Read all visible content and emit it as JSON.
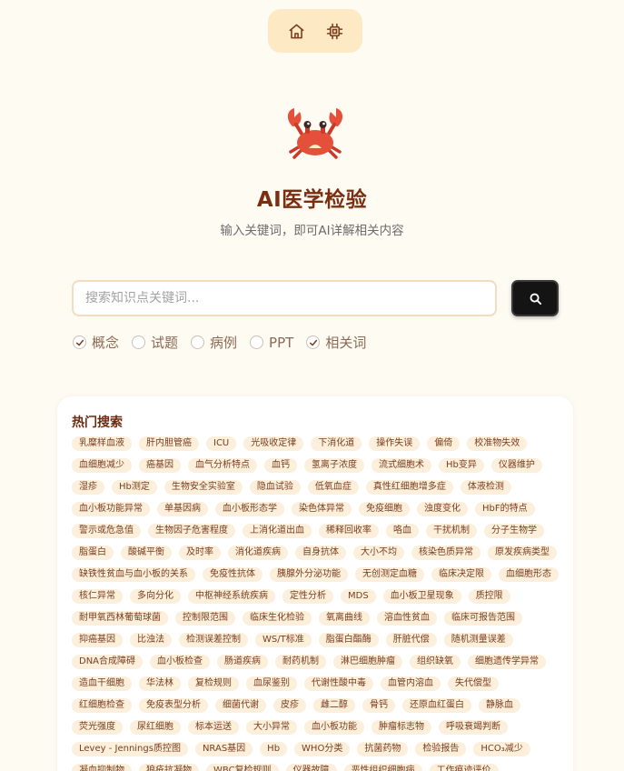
{
  "nav": {
    "home_icon": "home-icon",
    "chip_icon": "chip-icon"
  },
  "hero": {
    "logo_icon": "crab-icon",
    "title": "AI医学检验",
    "subtitle": "输入关键词，即可AI详解相关内容"
  },
  "search": {
    "placeholder": "搜索知识点关键词...",
    "value": "",
    "button_icon": "search-icon"
  },
  "options": [
    {
      "label": "概念",
      "checked": true
    },
    {
      "label": "试题",
      "checked": false
    },
    {
      "label": "病例",
      "checked": false
    },
    {
      "label": "PPT",
      "checked": false
    },
    {
      "label": "相关词",
      "checked": true
    }
  ],
  "hot": {
    "title": "热门搜索",
    "tags": [
      "乳糜样血液",
      "肝内胆管癌",
      "ICU",
      "光吸收定律",
      "下消化道",
      "操作失误",
      "偏倚",
      "校准物失效",
      "血细胞减少",
      "癌基因",
      "血气分析特点",
      "血钙",
      "氢离子浓度",
      "流式细胞术",
      "Hb变异",
      "仪器维护",
      "湿疹",
      "Hb测定",
      "生物安全实验室",
      "隐血试验",
      "低氧血症",
      "真性红细胞增多症",
      "体液检测",
      "血小板功能异常",
      "单基因病",
      "血小板形态学",
      "染色体异常",
      "免疫细胞",
      "浊度变化",
      "HbF的特点",
      "警示或危急值",
      "生物因子危害程度",
      "上消化道出血",
      "稀释回收率",
      "咯血",
      "干扰机制",
      "分子生物学",
      "脂蛋白",
      "酸碱平衡",
      "及时率",
      "消化道疾病",
      "自身抗体",
      "大小不均",
      "核染色质异常",
      "原发疾病类型",
      "缺铁性贫血与血小板的关系",
      "免疫性抗体",
      "胰腺外分泌功能",
      "无创测定血糖",
      "临床决定限",
      "血细胞形态",
      "核仁异常",
      "多向分化",
      "中枢神经系统疾病",
      "定性分析",
      "MDS",
      "血小板卫星现象",
      "质控限",
      "耐甲氧西林葡萄球菌",
      "控制限范围",
      "临床生化检验",
      "氧离曲线",
      "溶血性贫血",
      "临床可报告范围",
      "抑癌基因",
      "比浊法",
      "检测误差控制",
      "WS/T标准",
      "脂蛋白酯酶",
      "肝脏代偿",
      "随机测量误差",
      "DNA合成障碍",
      "血小板检查",
      "肠道疾病",
      "耐药机制",
      "淋巴细胞肿瘤",
      "组织缺氧",
      "细胞遗传学异常",
      "造血干细胞",
      "华法林",
      "复检规则",
      "血尿鉴别",
      "代谢性酸中毒",
      "血管内溶血",
      "失代偿型",
      "红细胞检查",
      "免疫表型分析",
      "细菌代谢",
      "皮疹",
      "雌二醇",
      "骨钙",
      "还原血红蛋白",
      "静脉血",
      "荧光强度",
      "尿红细胞",
      "标本运送",
      "大小异常",
      "血小板功能",
      "肿瘤标志物",
      "呼吸衰竭判断",
      "Levey - Jennings质控图",
      "NRAS基因",
      "Hb",
      "WHO分类",
      "抗菌药物",
      "检验报告",
      "HCO₃减少",
      "凝血抑制物",
      "狼疮抗凝物",
      "WBC复检规则",
      "仪器故障",
      "恶性组织细胞病",
      "工作痕迹评价"
    ]
  }
}
